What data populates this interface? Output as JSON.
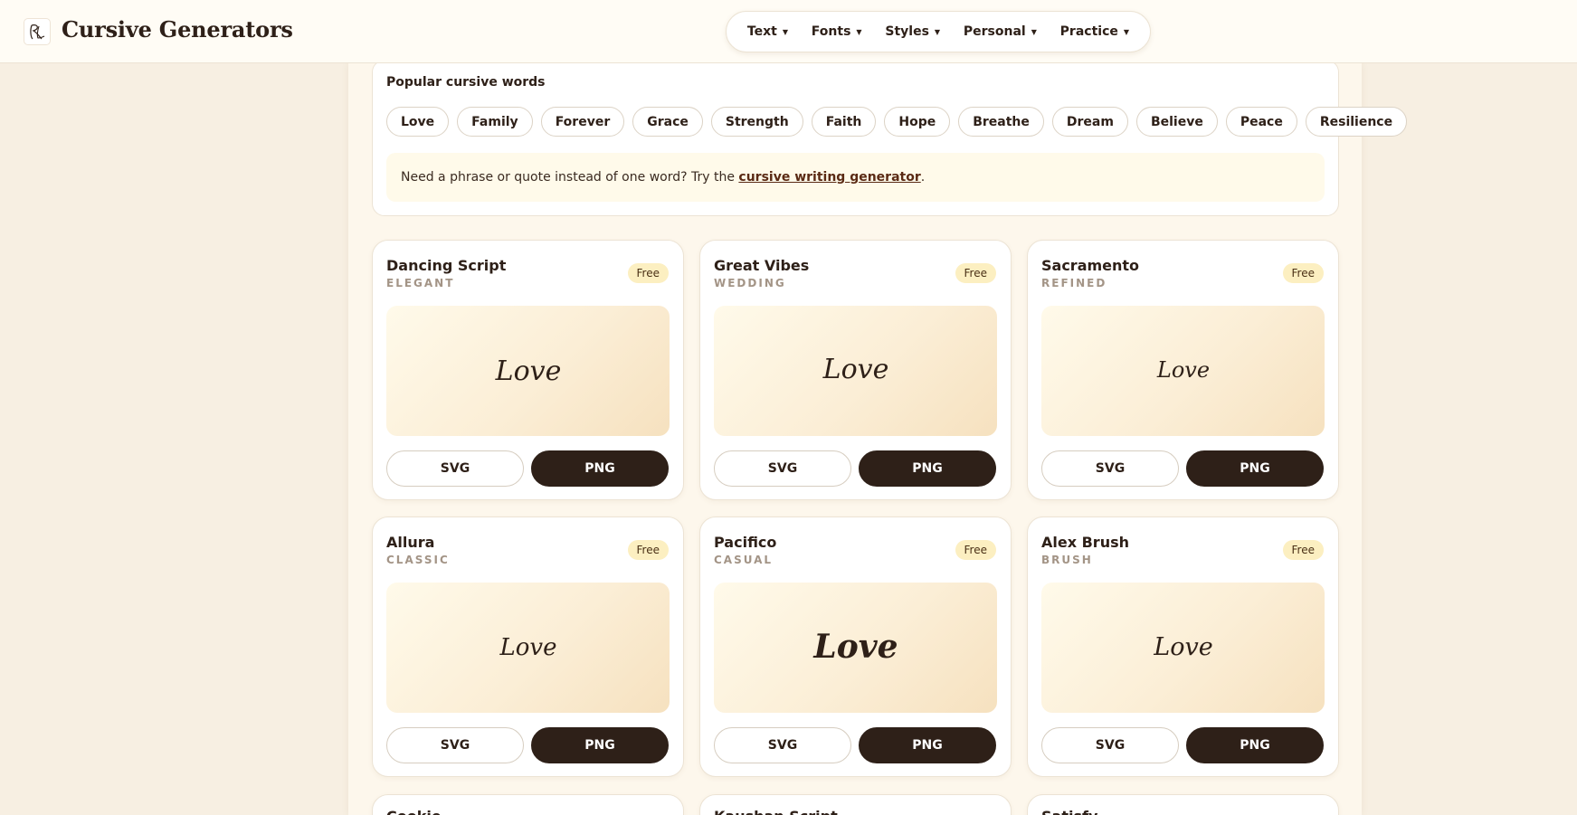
{
  "site": {
    "logo_glyph": "RL",
    "name": "Cursive Generators"
  },
  "nav": {
    "items": [
      {
        "label": "Text"
      },
      {
        "label": "Fonts"
      },
      {
        "label": "Styles"
      },
      {
        "label": "Personal"
      },
      {
        "label": "Practice"
      }
    ],
    "caret": "▾"
  },
  "popular": {
    "title": "Popular cursive words",
    "words": [
      "Love",
      "Family",
      "Forever",
      "Grace",
      "Strength",
      "Faith",
      "Hope",
      "Breathe",
      "Dream",
      "Believe",
      "Peace",
      "Resilience"
    ],
    "tip_prefix": "Need a phrase or quote instead of one word? Try the ",
    "tip_link": "cursive writing generator",
    "tip_suffix": "."
  },
  "cards": [
    {
      "name": "Dancing Script",
      "category": "ELEGANT",
      "badge": "Free",
      "preview": "Love",
      "svg_label": "SVG",
      "png_label": "PNG"
    },
    {
      "name": "Great Vibes",
      "category": "WEDDING",
      "badge": "Free",
      "preview": "Love",
      "svg_label": "SVG",
      "png_label": "PNG"
    },
    {
      "name": "Sacramento",
      "category": "REFINED",
      "badge": "Free",
      "preview": "Love",
      "svg_label": "SVG",
      "png_label": "PNG"
    },
    {
      "name": "Allura",
      "category": "CLASSIC",
      "badge": "Free",
      "preview": "Love",
      "svg_label": "SVG",
      "png_label": "PNG"
    },
    {
      "name": "Pacifico",
      "category": "CASUAL",
      "badge": "Free",
      "preview": "Love",
      "svg_label": "SVG",
      "png_label": "PNG"
    },
    {
      "name": "Alex Brush",
      "category": "BRUSH",
      "badge": "Free",
      "preview": "Love",
      "svg_label": "SVG",
      "png_label": "PNG"
    }
  ],
  "partial_cards": [
    {
      "name": "Cookie"
    },
    {
      "name": "Kaushan Script"
    },
    {
      "name": "Satisfy"
    }
  ],
  "colors": {
    "page_bg": "#f7efe2",
    "ink": "#2e2018",
    "badge_bg": "#fcefc1",
    "link": "#5a2a14"
  }
}
